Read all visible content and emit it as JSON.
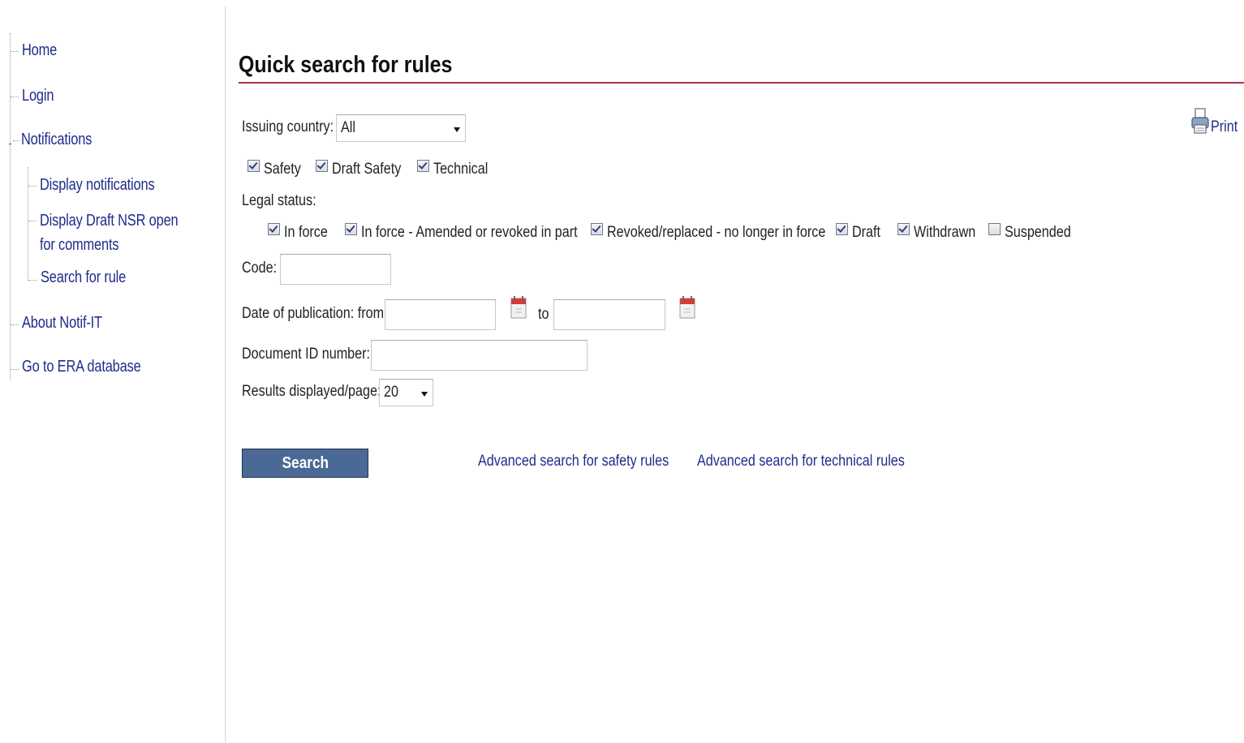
{
  "sidebar": {
    "items": [
      {
        "label": "Home"
      },
      {
        "label": "Login"
      },
      {
        "label": "Notifications"
      },
      {
        "label": "Display notifications"
      },
      {
        "label": "Display Draft NSR open for comments"
      },
      {
        "label": "Search for rule"
      },
      {
        "label": "About Notif-IT"
      },
      {
        "label": "Go to ERA database"
      }
    ]
  },
  "page": {
    "title": "Quick search for rules",
    "print_label": "Print",
    "print_icon": "printer-icon"
  },
  "form": {
    "issuing_country_label": "Issuing country:",
    "issuing_country_value": "All",
    "rule_types": [
      {
        "label": "Safety",
        "checked": true
      },
      {
        "label": "Draft Safety",
        "checked": true
      },
      {
        "label": "Technical",
        "checked": true
      }
    ],
    "legal_status_label": "Legal status:",
    "legal_statuses": [
      {
        "label": "In force",
        "checked": true
      },
      {
        "label": "In force - Amended or revoked in part",
        "checked": true
      },
      {
        "label": "Revoked/replaced - no longer in force",
        "checked": true
      },
      {
        "label": "Draft",
        "checked": true
      },
      {
        "label": "Withdrawn",
        "checked": true
      },
      {
        "label": "Suspended",
        "checked": false
      }
    ],
    "code_label": "Code:",
    "code_value": "",
    "date_label": "Date of publication: from",
    "date_from_value": "",
    "date_to_label": "to",
    "date_to_value": "",
    "calendar_icon": "calendar-icon",
    "doc_id_label": "Document ID number:",
    "doc_id_value": "",
    "results_label": "Results displayed/page:",
    "results_value": "20"
  },
  "actions": {
    "search_label": "Search",
    "adv_safety_label": "Advanced search for safety rules",
    "adv_technical_label": "Advanced search for technical rules"
  },
  "colors": {
    "link": "#1f2b8c",
    "title_rule": "#b0334a",
    "button": "#4a6a95"
  }
}
